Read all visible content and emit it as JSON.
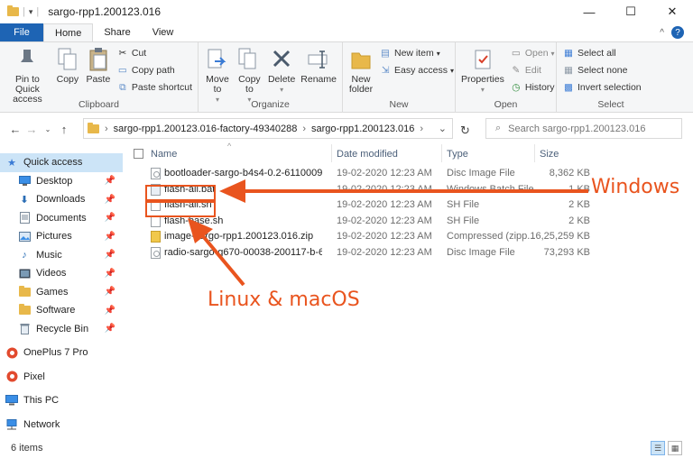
{
  "window": {
    "title": "sargo-rpp1.200123.016",
    "minimize": "—",
    "maximize": "☐",
    "close": "✕"
  },
  "tabs": [
    "File",
    "Home",
    "Share",
    "View"
  ],
  "ribbon": {
    "clipboard": {
      "label": "Clipboard",
      "pin": "Pin to Quick access",
      "copy": "Copy",
      "paste": "Paste",
      "cut": "Cut",
      "copy_path": "Copy path",
      "paste_shortcut": "Paste shortcut"
    },
    "organize": {
      "label": "Organize",
      "move_to": "Move to",
      "copy_to": "Copy to",
      "delete": "Delete",
      "rename": "Rename"
    },
    "new": {
      "label": "New",
      "new_folder": "New folder",
      "new_item": "New item",
      "easy_access": "Easy access"
    },
    "open": {
      "label": "Open",
      "properties": "Properties",
      "open": "Open",
      "edit": "Edit",
      "history": "History"
    },
    "select": {
      "label": "Select",
      "select_all": "Select all",
      "select_none": "Select none",
      "invert": "Invert selection"
    }
  },
  "address": {
    "crumbs": [
      "sargo-rpp1.200123.016-factory-49340288",
      "sargo-rpp1.200123.016"
    ],
    "search_placeholder": "Search sargo-rpp1.200123.016"
  },
  "sidebar": {
    "quick_access": "Quick access",
    "pinned": [
      "Desktop",
      "Downloads",
      "Documents",
      "Pictures",
      "Music",
      "Videos",
      "Games",
      "Software",
      "Recycle Bin"
    ],
    "devices": [
      "OnePlus 7 Pro",
      "Pixel",
      "This PC",
      "Network"
    ]
  },
  "columns": {
    "name": "Name",
    "date": "Date modified",
    "type": "Type",
    "size": "Size"
  },
  "files": [
    {
      "name": "bootloader-sargo-b4s4-0.2-6110009.i...",
      "date": "19-02-2020 12:23 AM",
      "type": "Disc Image File",
      "size": "8,362 KB"
    },
    {
      "name": "flash-all.bat",
      "date": "19-02-2020 12:23 AM",
      "type": "Windows Batch File",
      "size": "1 KB"
    },
    {
      "name": "flash-all.sh",
      "date": "19-02-2020 12:23 AM",
      "type": "SH File",
      "size": "2 KB"
    },
    {
      "name": "flash-base.sh",
      "date": "19-02-2020 12:23 AM",
      "type": "SH File",
      "size": "2 KB"
    },
    {
      "name": "image-sargo-rpp1.200123.016.zip",
      "date": "19-02-2020 12:23 AM",
      "type": "Compressed (zipp...",
      "size": "16,25,259 KB"
    },
    {
      "name": "radio-sargo-g670-00038-200117-b-614...",
      "date": "19-02-2020 12:23 AM",
      "type": "Disc Image File",
      "size": "73,293 KB"
    }
  ],
  "annotations": {
    "windows": "Windows",
    "linux_mac": "Linux & macOS"
  },
  "status": {
    "count": "6 items"
  },
  "colors": {
    "accent": "#1e64b4",
    "annotation": "#e9541e",
    "selected": "#cce4f7"
  }
}
